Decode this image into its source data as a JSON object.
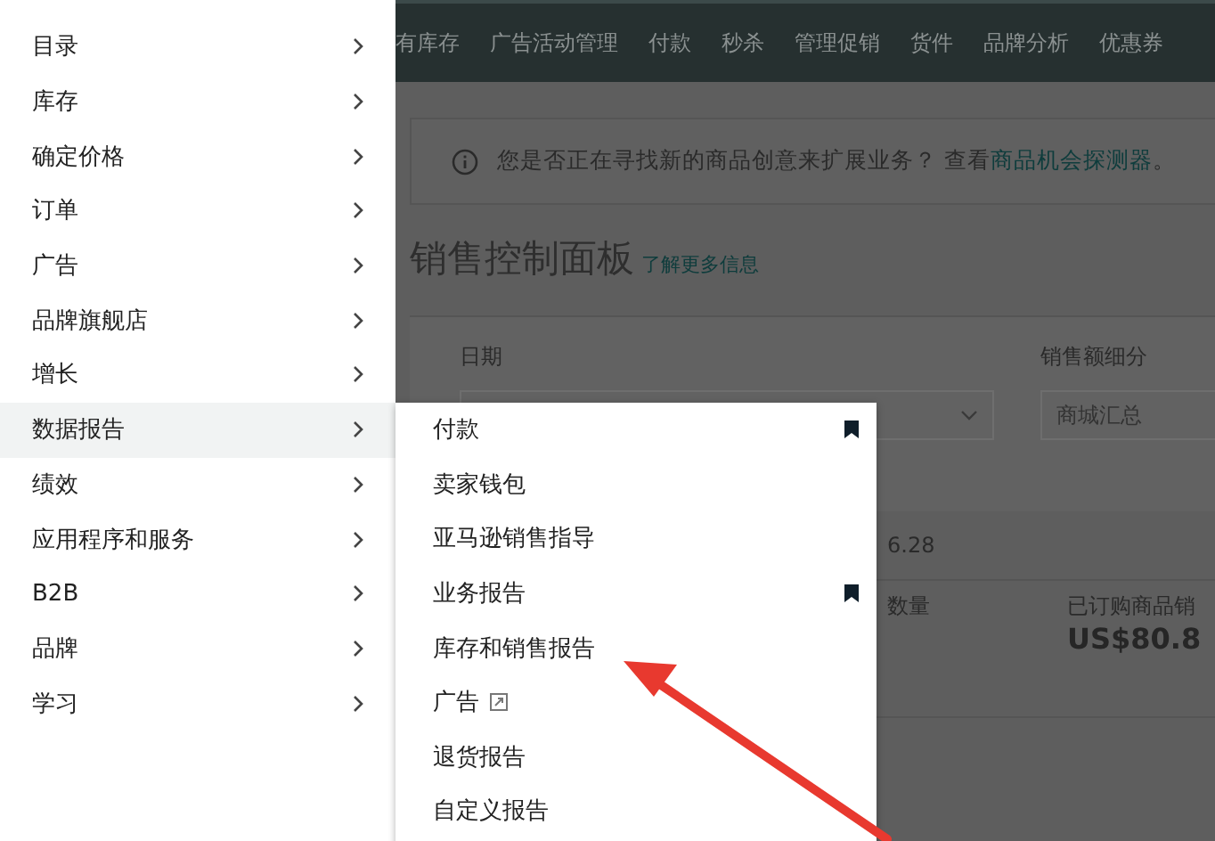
{
  "nav": {
    "items": [
      "有库存",
      "广告活动管理",
      "付款",
      "秒杀",
      "管理促销",
      "货件",
      "品牌分析",
      "优惠券"
    ]
  },
  "banner": {
    "text": "您是否正在寻找新的商品创意来扩展业务？ 查看",
    "link": "商品机会探测器",
    "end": "。"
  },
  "page_title": "销售控制面板",
  "learn_more": "了解更多信息",
  "filters": {
    "date_label": "日期",
    "breakdown_label": "销售额细分",
    "breakdown_value": "商城汇总"
  },
  "summary": {
    "date_fragment": "6.28",
    "metric_1_label": "数量",
    "metric_2_label": "已订购商品销",
    "metric_2_value": "US$80.8"
  },
  "menu": {
    "items": [
      {
        "label": "目录",
        "selected": false
      },
      {
        "label": "库存",
        "selected": false
      },
      {
        "label": "确定价格",
        "selected": false
      },
      {
        "label": "订单",
        "selected": false
      },
      {
        "label": "广告",
        "selected": false
      },
      {
        "label": "品牌旗舰店",
        "selected": false
      },
      {
        "label": "增长",
        "selected": false
      },
      {
        "label": "数据报告",
        "selected": true
      },
      {
        "label": "绩效",
        "selected": false
      },
      {
        "label": "应用程序和服务",
        "selected": false
      },
      {
        "label": "B2B",
        "selected": false
      },
      {
        "label": "品牌",
        "selected": false
      },
      {
        "label": "学习",
        "selected": false
      }
    ]
  },
  "submenu": {
    "items": [
      {
        "label": "付款",
        "bookmarked": true,
        "external": false
      },
      {
        "label": "卖家钱包",
        "bookmarked": false,
        "external": false
      },
      {
        "label": "亚马逊销售指导",
        "bookmarked": false,
        "external": false
      },
      {
        "label": "业务报告",
        "bookmarked": true,
        "external": false
      },
      {
        "label": "库存和销售报告",
        "bookmarked": false,
        "external": false
      },
      {
        "label": "广告",
        "bookmarked": false,
        "external": true
      },
      {
        "label": "退货报告",
        "bookmarked": false,
        "external": false
      },
      {
        "label": "自定义报告",
        "bookmarked": false,
        "external": false
      }
    ]
  }
}
